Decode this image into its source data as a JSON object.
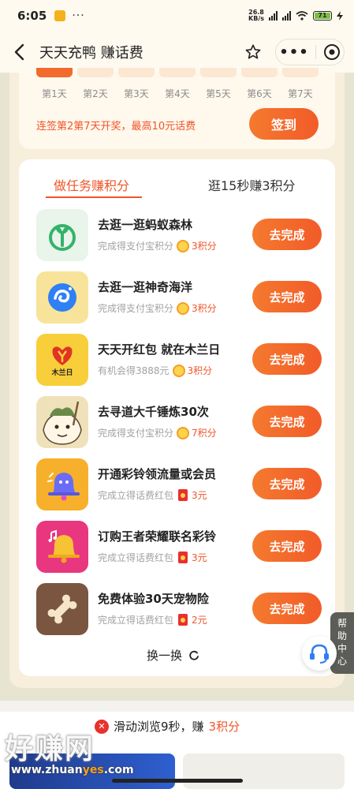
{
  "status": {
    "time": "6:05",
    "dots": "···",
    "speed_value": "26.8",
    "speed_unit": "KB/s",
    "battery": "71"
  },
  "nav": {
    "title": "天天充鸭 赚话费"
  },
  "signin": {
    "days": [
      "第1天",
      "第2天",
      "第3天",
      "第4天",
      "第5天",
      "第6天",
      "第7天"
    ],
    "notice": "连签第2第7天开奖，最高10元话费",
    "button": "签到"
  },
  "tabs": {
    "active": "做任务赚积分",
    "inactive": "逛15秒赚3积分"
  },
  "tasks": [
    {
      "title": "去逛一逛蚂蚁森林",
      "desc": "完成得支付宝积分",
      "reward": "3积分",
      "reward_type": "coin",
      "button": "去完成",
      "icon": "ant-forest-icon"
    },
    {
      "title": "去逛一逛神奇海洋",
      "desc": "完成得支付宝积分",
      "reward": "3积分",
      "reward_type": "coin",
      "button": "去完成",
      "icon": "magic-ocean-icon"
    },
    {
      "title": "天天开红包 就在木兰日",
      "desc": "有机会得3888元",
      "reward": "3积分",
      "reward_type": "coin",
      "button": "去完成",
      "icon": "mulan-day-icon",
      "icon_text": "木兰日"
    },
    {
      "title": "去寻道大千锤炼30次",
      "desc": "完成得支付宝积分",
      "reward": "7积分",
      "reward_type": "coin",
      "button": "去完成",
      "icon": "game-character-icon"
    },
    {
      "title": "开通彩铃领流量或会员",
      "desc": "完成立得话费红包",
      "reward": "3元",
      "reward_type": "redpacket",
      "button": "去完成",
      "icon": "ringtone-bell-icon"
    },
    {
      "title": "订购王者荣耀联名彩铃",
      "desc": "完成立得话费红包",
      "reward": "3元",
      "reward_type": "redpacket",
      "button": "去完成",
      "icon": "music-bell-icon"
    },
    {
      "title": "免费体验30天宠物险",
      "desc": "完成立得话费红包",
      "reward": "2元",
      "reward_type": "redpacket",
      "button": "去完成",
      "icon": "bone-icon"
    }
  ],
  "refresh": "换一换",
  "help": [
    "帮",
    "助",
    "中",
    "心"
  ],
  "browse": {
    "prefix": "滑动浏览9秒，赚",
    "highlight": "3积分"
  },
  "watermark": {
    "text": "好赚网",
    "url_a": "www.zhuan",
    "url_b": "yes",
    "url_c": ".com"
  },
  "colors": {
    "accent": "#f0552a",
    "button_gradient_start": "#f47a2e",
    "button_gradient_end": "#f25b29",
    "page_bg": "#f7eedb"
  }
}
